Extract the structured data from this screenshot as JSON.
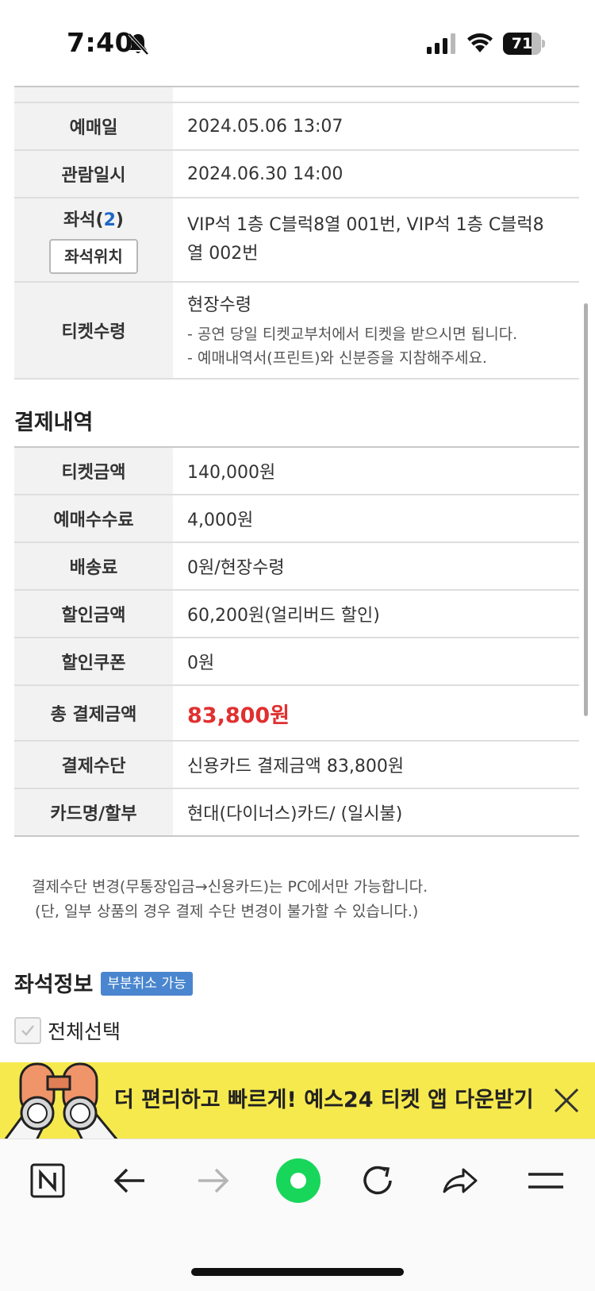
{
  "status_bar": {
    "time": "7:40",
    "battery": "71",
    "battery_level": 0.71
  },
  "booking_info": {
    "rows": [
      {
        "label": "예매일",
        "value": "2024.05.06 13:07"
      },
      {
        "label": "관람일시",
        "value": "2024.06.30 14:00"
      }
    ],
    "seat": {
      "label": "좌석(",
      "count": "2",
      "label_close": ")",
      "location_button": "좌석위치",
      "value_line1": "VIP석 1층 C블럭8열 001번, VIP석 1층 C블럭8",
      "value_line2": "열 002번"
    },
    "pickup": {
      "label": "티켓수령",
      "value": "현장수령",
      "note1": "- 공연 당일 티켓교부처에서 티켓을 받으시면 됩니다.",
      "note2": "- 예매내역서(프린트)와 신분증을 지참해주세요."
    }
  },
  "payment": {
    "title": "결제내역",
    "rows": [
      {
        "label": "티켓금액",
        "value": "140,000원"
      },
      {
        "label": "예매수수료",
        "value": "4,000원"
      },
      {
        "label": "배송료",
        "value": "0원/현장수령"
      },
      {
        "label": "할인금액",
        "value": "60,200원(얼리버드 할인)"
      },
      {
        "label": "할인쿠폰",
        "value": "0원"
      }
    ],
    "total": {
      "label": "총 결제금액",
      "value": "83,800원"
    },
    "method": {
      "label": "결제수단",
      "value": "신용카드 결제금액 83,800원"
    },
    "card": {
      "label": "카드명/할부",
      "value": "현대(다이너스)카드/ (일시불)"
    },
    "notice_line1": "결제수단 변경(무통장입금→신용카드)는 PC에서만 가능합니다.",
    "notice_line2": "(단, 일부 상품의 경우 결제 수단 변경이 불가할 수 있습니다.)"
  },
  "seat_info": {
    "title": "좌석정보",
    "badge": "부분취소 가능",
    "select_all": "전체선택"
  },
  "banner": {
    "text": "더 편리하고 빠르게! 예스24 티켓 앱 다운받기"
  },
  "toolbar": {
    "items": [
      "naver-home-icon",
      "back-arrow-icon",
      "forward-arrow-icon",
      "green-dot-icon",
      "reload-icon",
      "share-icon",
      "menu-icon"
    ]
  },
  "colors": {
    "total_red": "#e0302f",
    "badge_blue": "#4a86cf",
    "banner_yellow": "#f6e94d",
    "seat_count_blue": "#1d66c6"
  }
}
